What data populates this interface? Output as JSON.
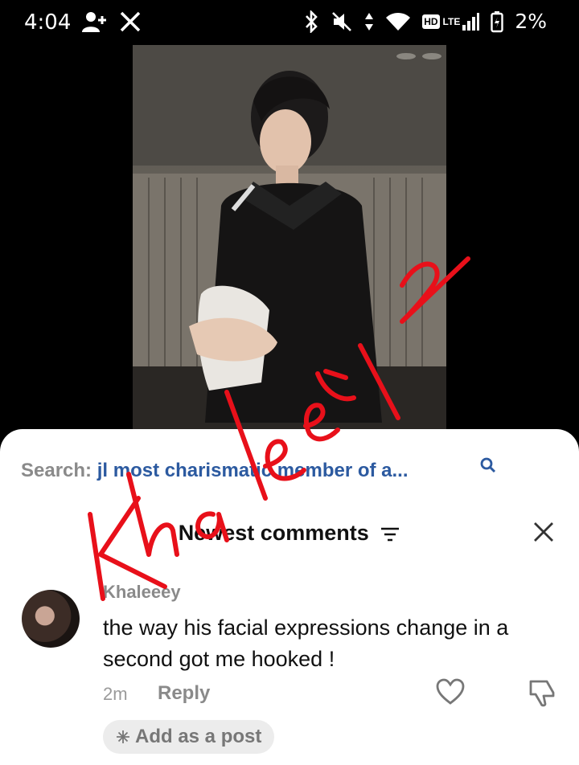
{
  "status_bar": {
    "time": "4:04",
    "battery": "2%",
    "network_badge_hd": "HD",
    "network_badge_lte": "LTE",
    "icons": [
      "person-add-icon",
      "x-logo-icon",
      "bluetooth-icon",
      "mute-icon",
      "data-arrows-icon",
      "wifi-icon",
      "signal-icon",
      "battery-icon"
    ]
  },
  "search": {
    "label": "Search:",
    "query": "jl most charismatic member of a..."
  },
  "comments_header": {
    "title": "Newest comments"
  },
  "comment": {
    "username": "Khaleeey",
    "text": "the way his facial expressions change in a second got me hooked !",
    "time": "2m",
    "reply_label": "Reply",
    "add_post_label": "Add as a post"
  },
  "colors": {
    "accent_link": "#2c5aa0",
    "scribble": "#e8101a"
  }
}
